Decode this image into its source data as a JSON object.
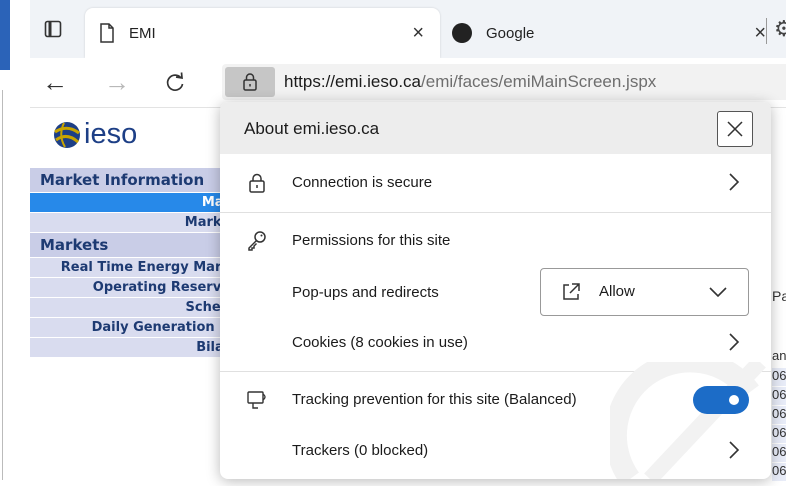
{
  "tabs": [
    {
      "title": "EMI",
      "close": "×"
    },
    {
      "title": "Google",
      "close": "×"
    }
  ],
  "address": {
    "host": "https://emi.ieso.ca",
    "rest": "/emi/faces/emiMainScreen.jspx"
  },
  "page": {
    "logo": "ieso",
    "menu": [
      "Market Information",
      "Mar",
      "Marke",
      "Markets",
      "Real Time Energy Mark",
      "Operating Reserve",
      "Sched",
      "Daily Generation D",
      "Bilat"
    ],
    "partial_text": "Pa",
    "column_header": "and",
    "column_cells": [
      "06",
      "06",
      "06",
      "06",
      "06",
      "06"
    ]
  },
  "popup": {
    "title": "About emi.ieso.ca",
    "connection": "Connection is secure",
    "permissions_heading": "Permissions for this site",
    "popups_label": "Pop-ups and redirects",
    "popups_value": "Allow",
    "cookies": "Cookies (8 cookies in use)",
    "tracking": "Tracking prevention for this site (Balanced)",
    "tracking_enabled": true,
    "trackers": "Trackers (0 blocked)"
  },
  "colors": {
    "accent": "#1c6cc7",
    "menu_selected": "#2789e9",
    "logo": "#1d3f86"
  },
  "icons": [
    "tab-actions-icon",
    "page-icon",
    "google-icon",
    "gear-icon",
    "back-icon",
    "forward-icon",
    "refresh-icon",
    "lock-icon",
    "close-icon",
    "key-icon",
    "external-link-icon",
    "chevron-down-icon",
    "chevron-right-icon",
    "tracking-icon"
  ]
}
